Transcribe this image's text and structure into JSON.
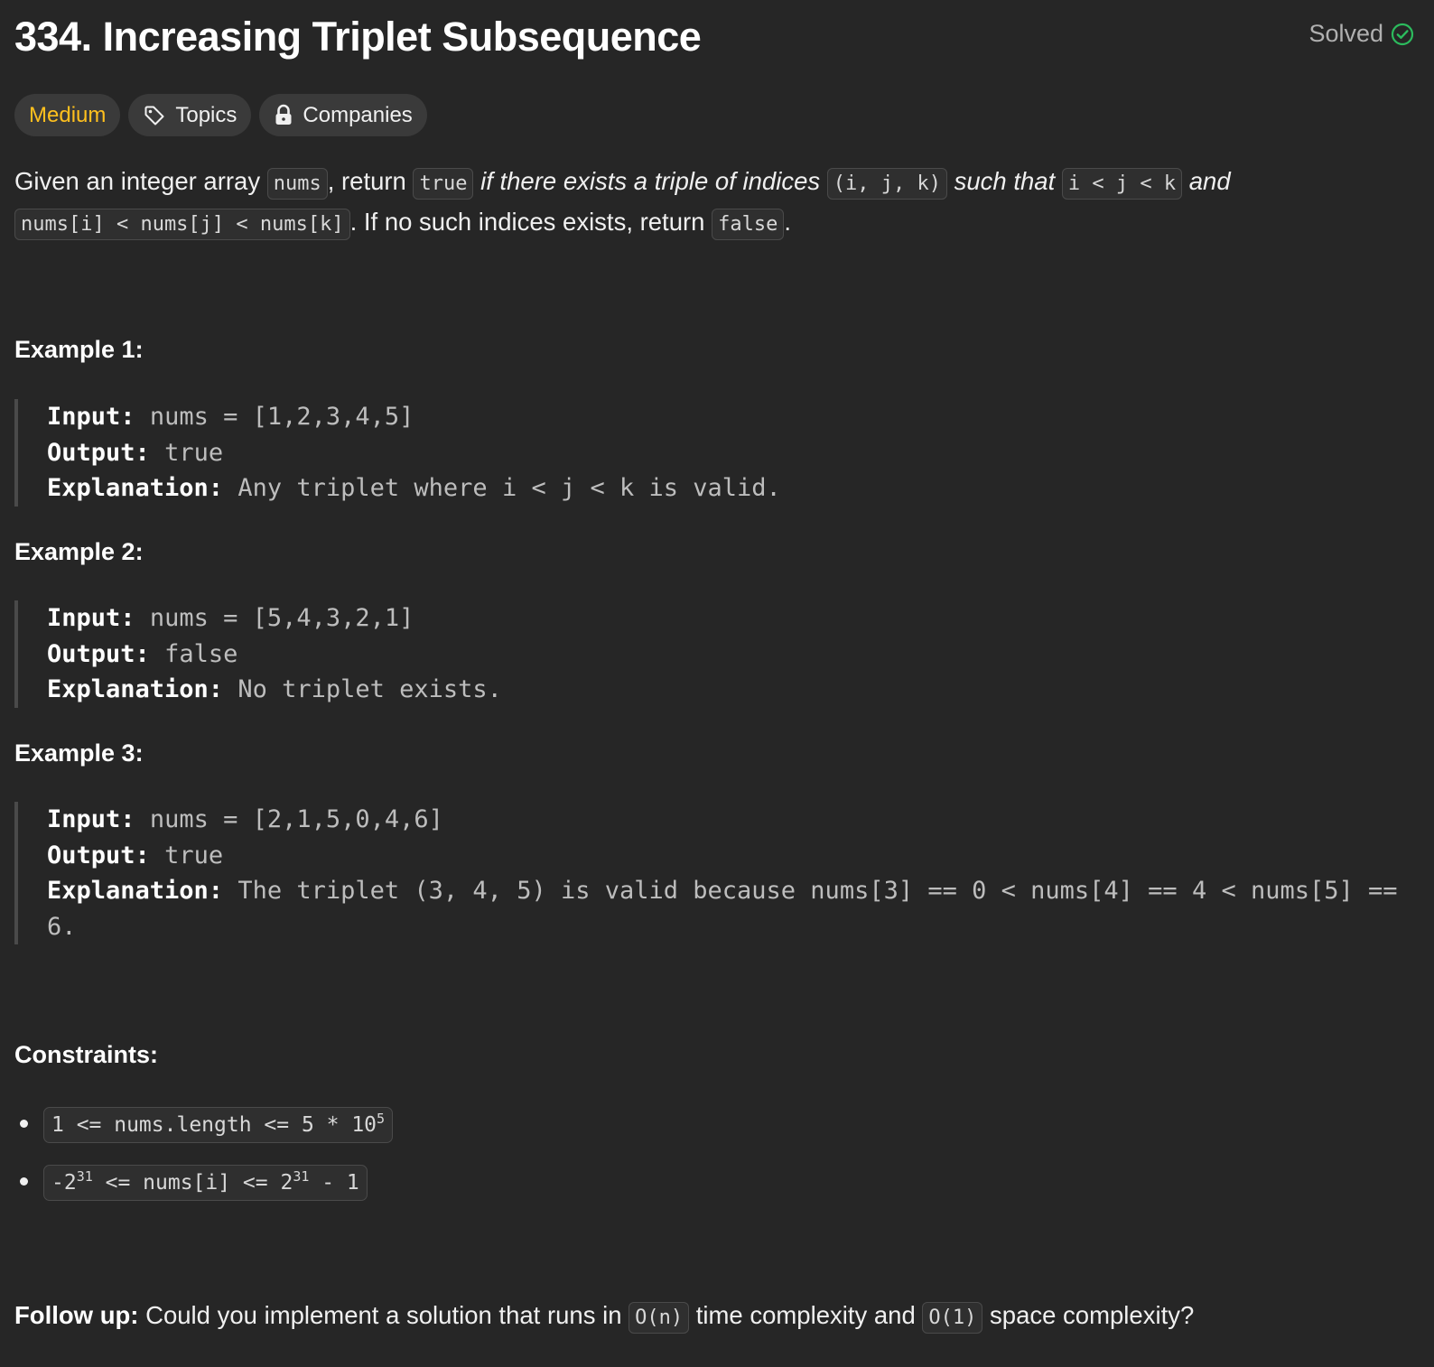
{
  "problem": {
    "title": "334. Increasing Triplet Subsequence",
    "status": "Solved",
    "tags": {
      "difficulty": "Medium",
      "topics": "Topics",
      "companies": "Companies"
    }
  },
  "description": {
    "t1": "Given an integer array ",
    "c1": "nums",
    "t2": ", return ",
    "c2": "true",
    "t3": " ",
    "i1": "if there exists a triple of indices",
    "t4": " ",
    "c3": "(i, j, k)",
    "t5": " ",
    "i2": "such that",
    "t6": " ",
    "c4": "i < j < k",
    "t7": " ",
    "i3": "and",
    "t8": " ",
    "c5": "nums[i] < nums[j] < nums[k]",
    "t9": ". If no such indices exists, return ",
    "c6": "false",
    "t10": "."
  },
  "examples": [
    {
      "title": "Example 1:",
      "input_label": "Input:",
      "input": "nums = [1,2,3,4,5]",
      "output_label": "Output:",
      "output": "true",
      "explanation_label": "Explanation:",
      "explanation": "Any triplet where i < j < k is valid."
    },
    {
      "title": "Example 2:",
      "input_label": "Input:",
      "input": "nums = [5,4,3,2,1]",
      "output_label": "Output:",
      "output": "false",
      "explanation_label": "Explanation:",
      "explanation": "No triplet exists."
    },
    {
      "title": "Example 3:",
      "input_label": "Input:",
      "input": "nums = [2,1,5,0,4,6]",
      "output_label": "Output:",
      "output": "true",
      "explanation_label": "Explanation:",
      "explanation": "The triplet (3, 4, 5) is valid because nums[3] == 0 < nums[4] == 4 < nums[5] == 6."
    }
  ],
  "constraints": {
    "title": "Constraints:",
    "c1": {
      "pre": "1 <= nums.length <= 5 * 10",
      "sup": "5"
    },
    "c2": {
      "pre": "-2",
      "sup1": "31",
      "mid": " <= nums[i] <= 2",
      "sup2": "31",
      "post": " - 1"
    }
  },
  "followup": {
    "label": "Follow up:",
    "t1": " Could you implement a solution that runs in ",
    "c1": "O(n)",
    "t2": " time complexity and ",
    "c2": "O(1)",
    "t3": " space complexity?"
  },
  "colors": {
    "background": "#262626",
    "difficulty_medium": "#ffc01e",
    "solved_check": "#2cbb5d"
  },
  "icons": {
    "solved": "check-circle-icon",
    "topics": "tag-icon",
    "companies": "lock-icon"
  }
}
